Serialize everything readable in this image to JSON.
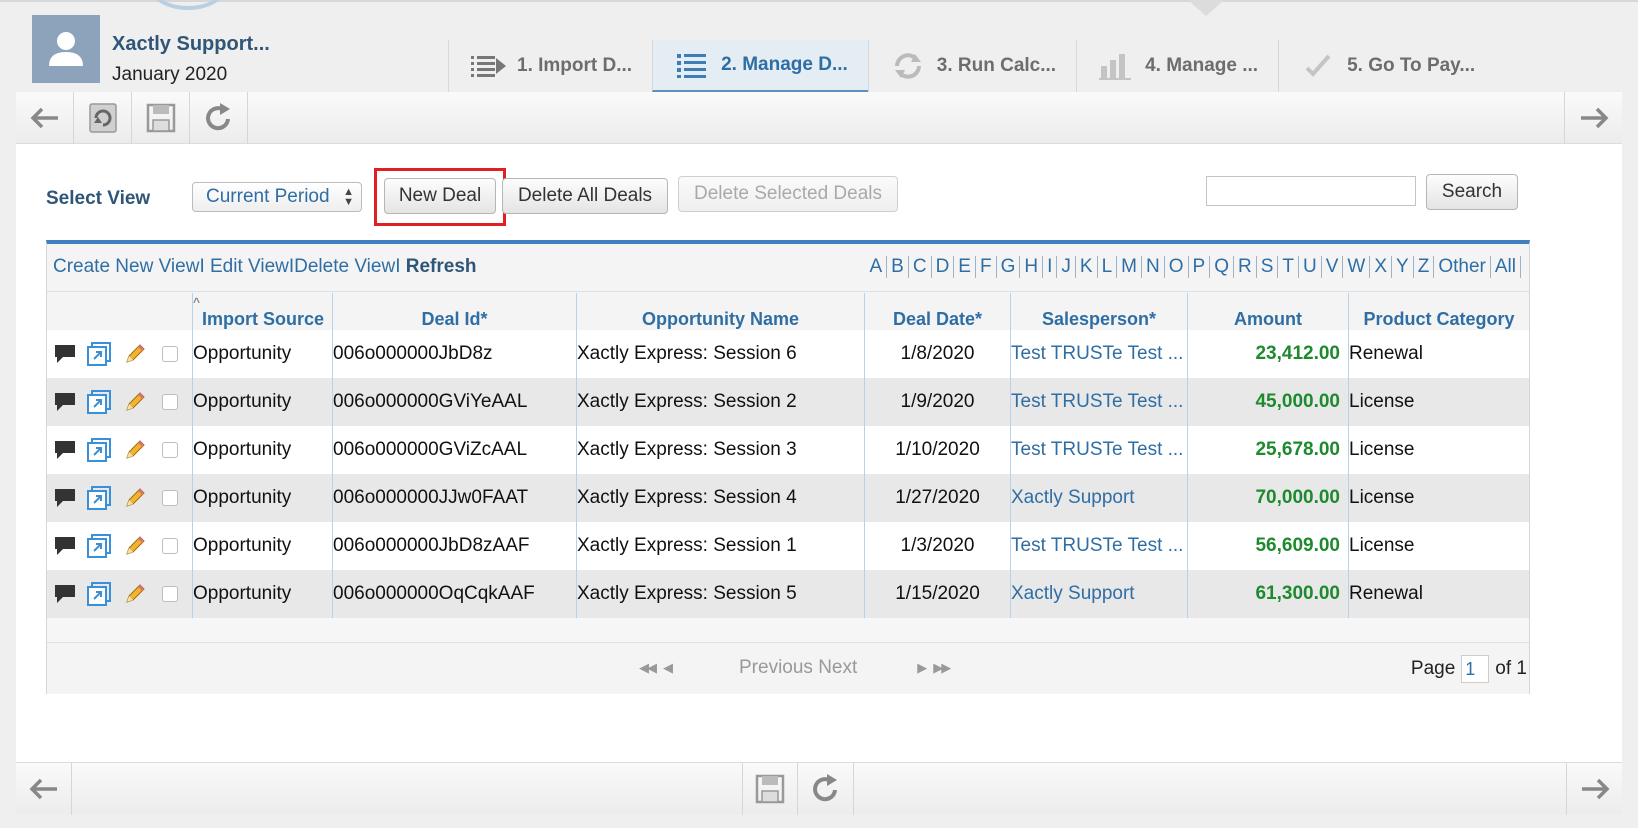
{
  "header": {
    "user_name": "Xactly Support...",
    "period": "January 2020",
    "steps": [
      {
        "label": "1. Import D...",
        "icon": "list-arrow-icon"
      },
      {
        "label": "2. Manage D...",
        "icon": "list-icon",
        "active": true
      },
      {
        "label": "3. Run Calc...",
        "icon": "refresh-cycle-icon"
      },
      {
        "label": "4. Manage ...",
        "icon": "bar-chart-icon"
      },
      {
        "label": "5. Go To Pay...",
        "icon": "checkmark-icon"
      }
    ]
  },
  "toolbar": {
    "icons": [
      "back-arrow-icon",
      "refresh-doc-icon",
      "save-icon",
      "redo-icon",
      "forward-arrow-icon"
    ]
  },
  "view_row": {
    "select_view_label": "Select View",
    "selected_view": "Current Period",
    "new_deal": "New Deal",
    "delete_all": "Delete All Deals",
    "delete_selected": "Delete Selected Deals",
    "search_value": "",
    "search_button": "Search"
  },
  "grid": {
    "links": {
      "create": "Create New View",
      "edit": "Edit View",
      "delete": "Delete View",
      "sep": "I",
      "refresh": "Refresh"
    },
    "alphabet": [
      "A",
      "B",
      "C",
      "D",
      "E",
      "F",
      "G",
      "H",
      "I",
      "J",
      "K",
      "L",
      "M",
      "N",
      "O",
      "P",
      "Q",
      "R",
      "S",
      "T",
      "U",
      "V",
      "W",
      "X",
      "Y",
      "Z",
      "Other",
      "All"
    ],
    "columns": [
      "Import Source",
      "Deal Id*",
      "Opportunity Name",
      "Deal Date*",
      "Salesperson*",
      "Amount",
      "Product Category"
    ],
    "rows": [
      {
        "source": "Opportunity",
        "deal_id": "006o000000JbD8z",
        "name": "Xactly Express: Session 6",
        "date": "1/8/2020",
        "salesperson": "Test TRUSTe Test ...",
        "amount": "23,412.00",
        "category": "Renewal"
      },
      {
        "source": "Opportunity",
        "deal_id": "006o000000GViYeAAL",
        "name": "Xactly Express: Session 2",
        "date": "1/9/2020",
        "salesperson": "Test TRUSTe Test ...",
        "amount": "45,000.00",
        "category": "License"
      },
      {
        "source": "Opportunity",
        "deal_id": "006o000000GViZcAAL",
        "name": "Xactly Express: Session 3",
        "date": "1/10/2020",
        "salesperson": "Test TRUSTe Test ...",
        "amount": "25,678.00",
        "category": "License"
      },
      {
        "source": "Opportunity",
        "deal_id": "006o000000JJw0FAAT",
        "name": "Xactly Express: Session 4",
        "date": "1/27/2020",
        "salesperson": "Xactly Support",
        "amount": "70,000.00",
        "category": "License"
      },
      {
        "source": "Opportunity",
        "deal_id": "006o000000JbD8zAAF",
        "name": "Xactly Express: Session 1",
        "date": "1/3/2020",
        "salesperson": "Test TRUSTe Test ...",
        "amount": "56,609.00",
        "category": "License"
      },
      {
        "source": "Opportunity",
        "deal_id": "006o000000OqCqkAAF",
        "name": "Xactly Express: Session 5",
        "date": "1/15/2020",
        "salesperson": "Xactly Support",
        "amount": "61,300.00",
        "category": "Renewal"
      }
    ],
    "pager": {
      "prev": "Previous",
      "next": "Next",
      "page_label": "Page",
      "page_value": "1",
      "of_label": "of 1"
    }
  },
  "colors": {
    "accent": "#2f6ea4",
    "amount_green": "#1e8a2e",
    "highlight_red": "#e02020"
  }
}
